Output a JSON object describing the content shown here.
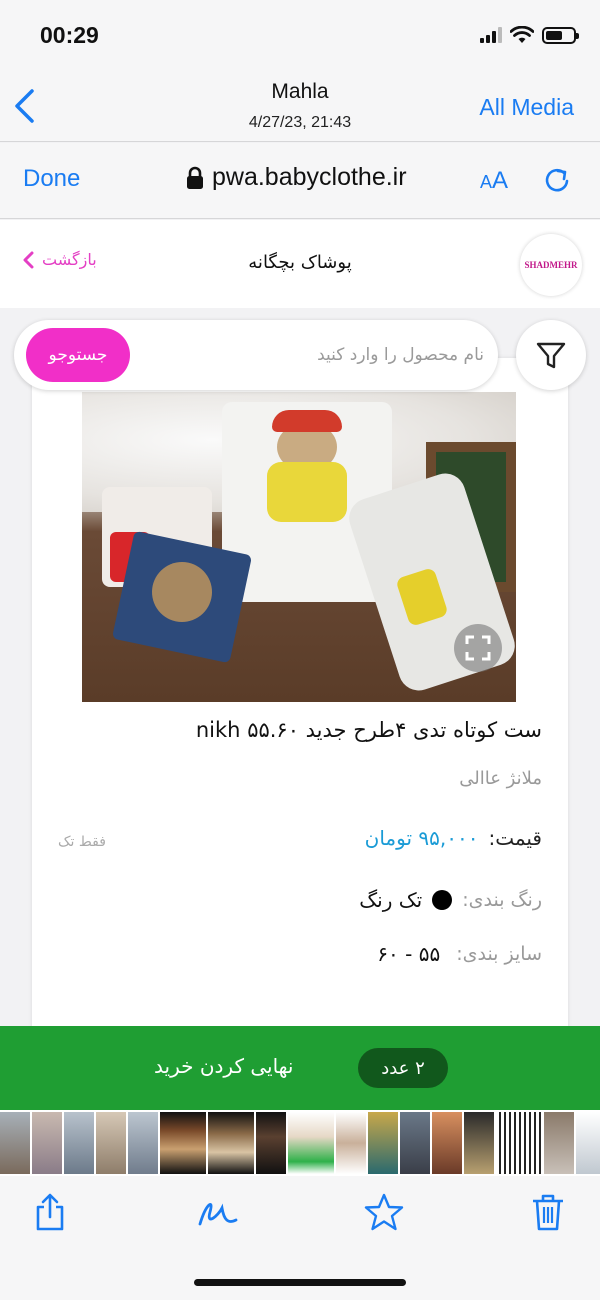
{
  "status_bar": {
    "time": "00:29"
  },
  "photo_nav": {
    "title": "Mahla",
    "subtitle": "4/27/23, 21:43",
    "all_media": "All Media"
  },
  "safari": {
    "done": "Done",
    "url": "pwa.babyclothe.ir",
    "aa_small": "A",
    "aa_big": "A"
  },
  "site_header": {
    "title": "پوشاک بچگانه",
    "back_label": "بازگشت",
    "logo_text": "SHADMEHR"
  },
  "search": {
    "placeholder": "نام محصول را وارد کنید",
    "button": "جستوجو"
  },
  "product": {
    "name": "ست کوتاه تدی ۴طرح جدید ۵۵.۶۰ nikh",
    "store": "ملانژ عاالی",
    "price_label": "قیمت:",
    "price_value": "۹۵,۰۰۰ تومان",
    "single_note": "فقط تک",
    "color_label": "رنگ بندی:",
    "color_value": "تک رنگ",
    "size_label": "سایز بندی:",
    "size_value": "۵۵ - ۶۰"
  },
  "checkout": {
    "label": "نهایی کردن خرید",
    "qty": "۲ عدد"
  },
  "colors": {
    "ios_blue": "#1a7cf2",
    "brand_pink": "#f12fc8",
    "checkout_green": "#1f9e33",
    "price_blue": "#1a9bd6"
  },
  "toolbar_icons": [
    "share-icon",
    "markup-icon",
    "favorite-icon",
    "trash-icon"
  ]
}
